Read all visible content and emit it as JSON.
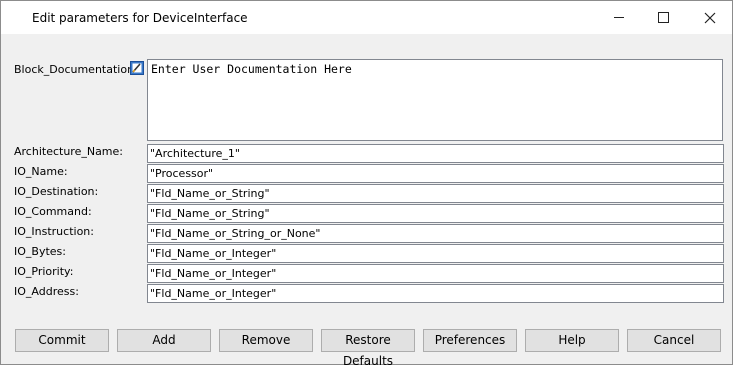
{
  "window": {
    "title": "Edit parameters for DeviceInterface"
  },
  "documentation": {
    "label": "Block_Documentation:",
    "value": "Enter User Documentation Here",
    "icon": "edit-doc-icon"
  },
  "params": [
    {
      "label": "Architecture_Name:",
      "value": "\"Architecture_1\""
    },
    {
      "label": "IO_Name:",
      "value": "\"Processor\""
    },
    {
      "label": "IO_Destination:",
      "value": "\"Fld_Name_or_String\""
    },
    {
      "label": "IO_Command:",
      "value": "\"Fld_Name_or_String\""
    },
    {
      "label": "IO_Instruction:",
      "value": "\"Fld_Name_or_String_or_None\""
    },
    {
      "label": "IO_Bytes:",
      "value": "\"Fld_Name_or_Integer\""
    },
    {
      "label": "IO_Priority:",
      "value": "\"Fld_Name_or_Integer\""
    },
    {
      "label": "IO_Address:",
      "value": "\"Fld_Name_or_Integer\""
    }
  ],
  "buttons": {
    "commit": "Commit",
    "add": "Add",
    "remove": "Remove",
    "restore": "Restore Defaults",
    "preferences": "Preferences",
    "help": "Help",
    "cancel": "Cancel"
  }
}
